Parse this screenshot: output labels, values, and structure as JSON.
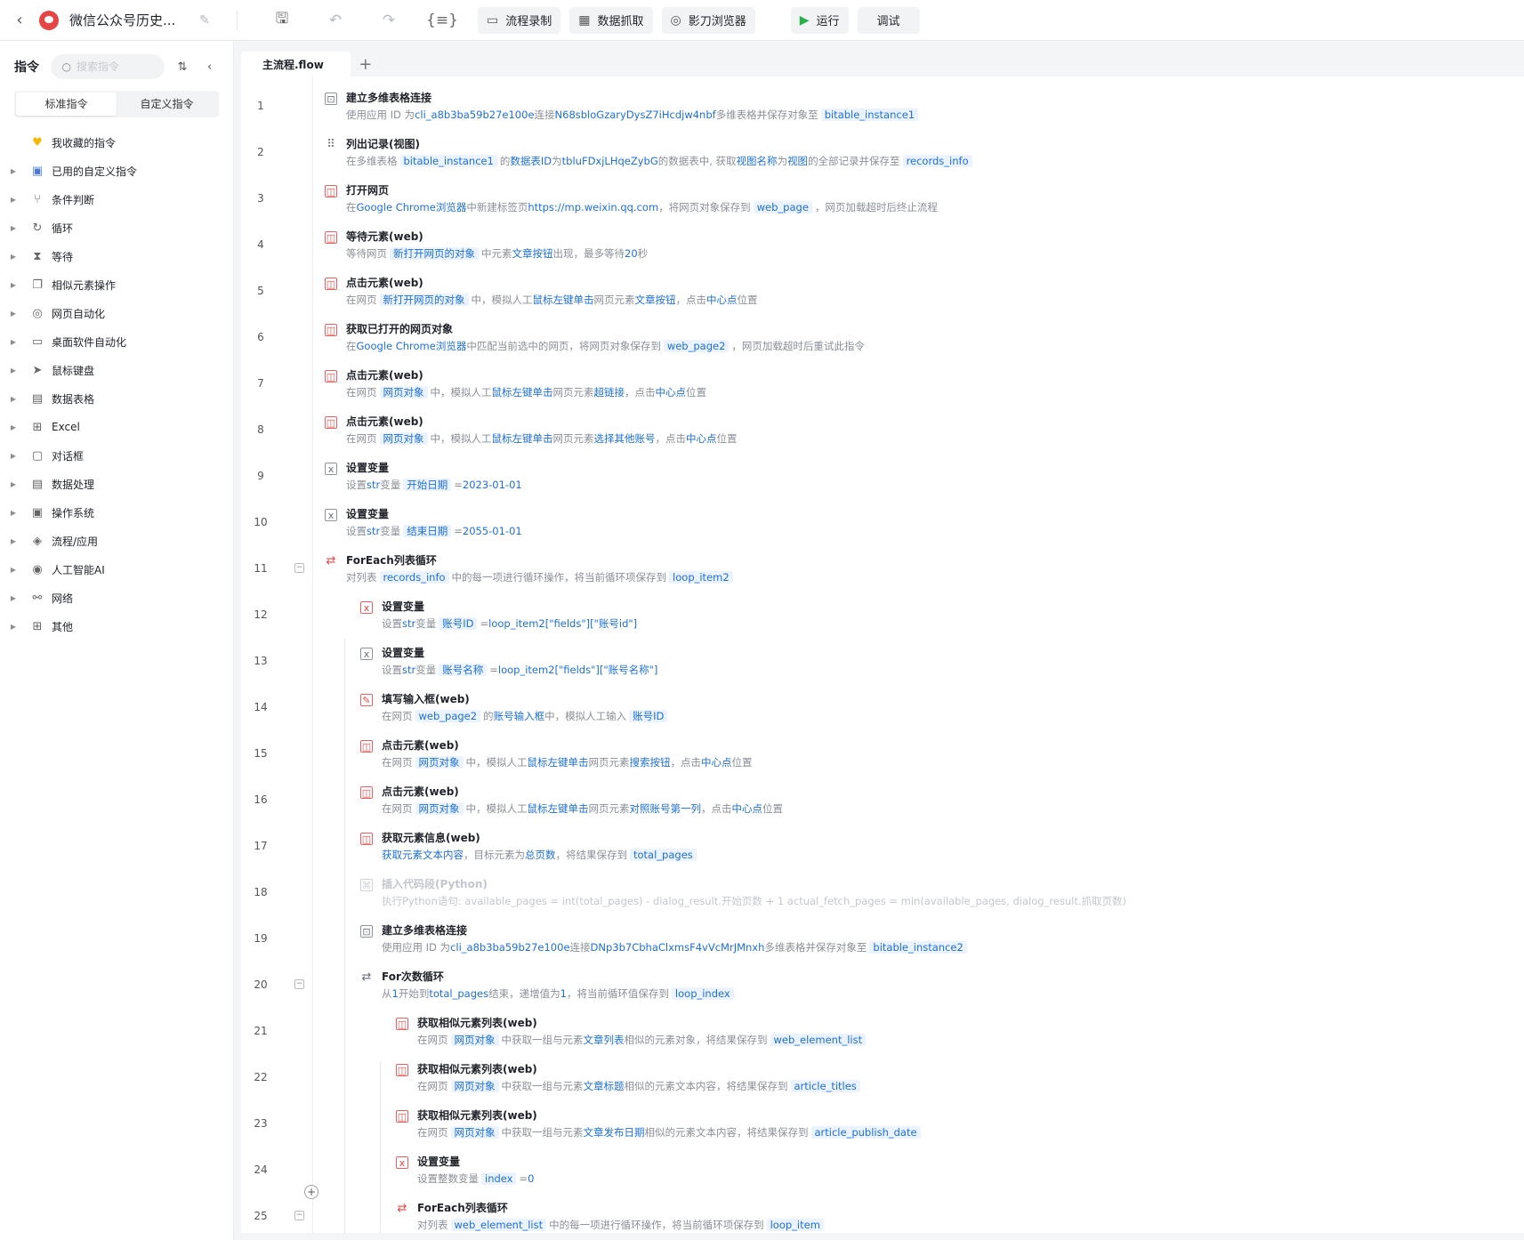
{
  "header": {
    "back_icon": "chevron-left",
    "app_title": "微信公众号历史...",
    "toolbar": {
      "flow_record": "流程录制",
      "data_capture": "数据抓取",
      "shadow_browser": "影刀浏览器",
      "run": "运行",
      "debug": "调试"
    }
  },
  "sidebar": {
    "title": "指令",
    "search_placeholder": "搜索指令",
    "tabs": [
      "标准指令",
      "自定义指令"
    ],
    "items": [
      {
        "label": "我收藏的指令",
        "icon": "heart-icon",
        "expandable": false
      },
      {
        "label": "已用的自定义指令",
        "icon": "calendar-icon",
        "expandable": true
      },
      {
        "label": "条件判断",
        "icon": "branch-icon",
        "expandable": true
      },
      {
        "label": "循环",
        "icon": "loop-icon",
        "expandable": true
      },
      {
        "label": "等待",
        "icon": "hourglass-icon",
        "expandable": true
      },
      {
        "label": "相似元素操作",
        "icon": "copy-icon",
        "expandable": true
      },
      {
        "label": "网页自动化",
        "icon": "browser-icon",
        "expandable": true
      },
      {
        "label": "桌面软件自动化",
        "icon": "monitor-icon",
        "expandable": true
      },
      {
        "label": "鼠标键盘",
        "icon": "cursor-icon",
        "expandable": true
      },
      {
        "label": "数据表格",
        "icon": "table-icon",
        "expandable": true
      },
      {
        "label": "Excel",
        "icon": "excel-icon",
        "expandable": true
      },
      {
        "label": "对话框",
        "icon": "dialog-icon",
        "expandable": true
      },
      {
        "label": "数据处理",
        "icon": "data-icon",
        "expandable": true
      },
      {
        "label": "操作系统",
        "icon": "os-icon",
        "expandable": true
      },
      {
        "label": "流程/应用",
        "icon": "layers-icon",
        "expandable": true
      },
      {
        "label": "人工智能AI",
        "icon": "ai-icon",
        "expandable": true
      },
      {
        "label": "网络",
        "icon": "network-icon",
        "expandable": true
      },
      {
        "label": "其他",
        "icon": "grid-icon",
        "expandable": true
      }
    ]
  },
  "editor": {
    "tab_name": "主流程.flow",
    "add_tab": "+",
    "steps": [
      {
        "n": "1",
        "depth": 0,
        "fold": false,
        "icon": "table-link-icon",
        "red": false,
        "title": "建立多维表格连接",
        "desc": [
          {
            "t": "使用应用 ID 为"
          },
          {
            "k": "cli_a8b3ba59b27e100e"
          },
          {
            "t": "连接"
          },
          {
            "k": "N68sbloGzaryDysZ7iHcdjw4nbf"
          },
          {
            "t": "多维表格并保存对象至"
          },
          {
            "v": "bitable_instance1"
          }
        ]
      },
      {
        "n": "2",
        "depth": 0,
        "fold": false,
        "icon": "grid-dots-icon",
        "red": false,
        "title": "列出记录(视图)",
        "desc": [
          {
            "t": "在多维表格"
          },
          {
            "v": "bitable_instance1"
          },
          {
            "t": "的"
          },
          {
            "k": "数据表ID"
          },
          {
            "t": "为"
          },
          {
            "k": "tbluFDxjLHqeZybG"
          },
          {
            "t": "的数据表中, 获取"
          },
          {
            "k": "视图名称"
          },
          {
            "t": "为"
          },
          {
            "k": "视图"
          },
          {
            "t": "的全部记录并保存至"
          },
          {
            "v": "records_info"
          }
        ]
      },
      {
        "n": "3",
        "depth": 0,
        "fold": false,
        "icon": "open-page-icon",
        "red": true,
        "title": "打开网页",
        "desc": [
          {
            "t": "在"
          },
          {
            "k": "Google Chrome浏览器"
          },
          {
            "t": "中新建标签页"
          },
          {
            "k": "https://mp.weixin.qq.com"
          },
          {
            "t": "，将网页对象保存到"
          },
          {
            "v": "web_page"
          },
          {
            "t": "，网页加载超时后终止流程"
          }
        ]
      },
      {
        "n": "4",
        "depth": 0,
        "fold": false,
        "icon": "wait-element-icon",
        "red": true,
        "title": "等待元素(web)",
        "desc": [
          {
            "t": "等待网页"
          },
          {
            "v": "新打开网页的对象"
          },
          {
            "t": "中元素"
          },
          {
            "k": "文章按钮"
          },
          {
            "t": "出现，最多等待"
          },
          {
            "k": "20"
          },
          {
            "t": "秒"
          }
        ]
      },
      {
        "n": "5",
        "depth": 0,
        "fold": false,
        "icon": "click-element-icon",
        "red": true,
        "title": "点击元素(web)",
        "desc": [
          {
            "t": "在网页"
          },
          {
            "v": "新打开网页的对象"
          },
          {
            "t": "中，模拟人工"
          },
          {
            "k": "鼠标左键单击"
          },
          {
            "t": "网页元素"
          },
          {
            "k": "文章按钮"
          },
          {
            "t": "，点击"
          },
          {
            "k": "中心点"
          },
          {
            "t": "位置"
          }
        ]
      },
      {
        "n": "6",
        "depth": 0,
        "fold": false,
        "icon": "get-page-icon",
        "red": true,
        "title": "获取已打开的网页对象",
        "desc": [
          {
            "t": "在"
          },
          {
            "k": "Google Chrome浏览器"
          },
          {
            "t": "中匹配当前选中的网页，将网页对象保存到"
          },
          {
            "v": "web_page2"
          },
          {
            "t": "，网页加载超时后重试此指令"
          }
        ]
      },
      {
        "n": "7",
        "depth": 0,
        "fold": false,
        "icon": "click-element-icon",
        "red": true,
        "title": "点击元素(web)",
        "desc": [
          {
            "t": "在网页"
          },
          {
            "v": "网页对象"
          },
          {
            "t": "中，模拟人工"
          },
          {
            "k": "鼠标左键单击"
          },
          {
            "t": "网页元素"
          },
          {
            "k": "超链接"
          },
          {
            "t": "，点击"
          },
          {
            "k": "中心点"
          },
          {
            "t": "位置"
          }
        ]
      },
      {
        "n": "8",
        "depth": 0,
        "fold": false,
        "icon": "click-element-icon",
        "red": true,
        "title": "点击元素(web)",
        "desc": [
          {
            "t": "在网页"
          },
          {
            "v": "网页对象"
          },
          {
            "t": "中，模拟人工"
          },
          {
            "k": "鼠标左键单击"
          },
          {
            "t": "网页元素"
          },
          {
            "k": "选择其他账号"
          },
          {
            "t": "，点击"
          },
          {
            "k": "中心点"
          },
          {
            "t": "位置"
          }
        ]
      },
      {
        "n": "9",
        "depth": 0,
        "fold": false,
        "icon": "variable-icon",
        "red": false,
        "title": "设置变量",
        "desc": [
          {
            "t": "设置"
          },
          {
            "k": "str"
          },
          {
            "t": "变量"
          },
          {
            "v": "开始日期"
          },
          {
            "t": "="
          },
          {
            "k": "2023-01-01"
          }
        ]
      },
      {
        "n": "10",
        "depth": 0,
        "fold": false,
        "icon": "variable-icon",
        "red": false,
        "title": "设置变量",
        "desc": [
          {
            "t": "设置"
          },
          {
            "k": "str"
          },
          {
            "t": "变量"
          },
          {
            "v": "结束日期"
          },
          {
            "t": "="
          },
          {
            "k": "2055-01-01"
          }
        ]
      },
      {
        "n": "11",
        "depth": 0,
        "fold": true,
        "icon": "foreach-icon",
        "red": true,
        "title": "ForEach列表循环",
        "desc": [
          {
            "t": "对列表"
          },
          {
            "v": "records_info"
          },
          {
            "t": "中的每一项进行循环操作，将当前循环项保存到"
          },
          {
            "v": "loop_item2"
          }
        ]
      },
      {
        "n": "12",
        "depth": 1,
        "fold": false,
        "icon": "variable-icon",
        "red": true,
        "title": "设置变量",
        "desc": [
          {
            "t": "设置"
          },
          {
            "k": "str"
          },
          {
            "t": "变量"
          },
          {
            "v": "账号ID"
          },
          {
            "t": "="
          },
          {
            "k": "loop_item2[\"fields\"][\"账号id\"]"
          }
        ]
      },
      {
        "n": "13",
        "depth": 1,
        "fold": false,
        "icon": "variable-icon",
        "red": false,
        "title": "设置变量",
        "desc": [
          {
            "t": "设置"
          },
          {
            "k": "str"
          },
          {
            "t": "变量"
          },
          {
            "v": "账号名称"
          },
          {
            "t": "="
          },
          {
            "k": "loop_item2[\"fields\"][\"账号名称\"]"
          }
        ]
      },
      {
        "n": "14",
        "depth": 1,
        "fold": false,
        "icon": "input-icon",
        "red": true,
        "title": "填写输入框(web)",
        "desc": [
          {
            "t": "在网页"
          },
          {
            "v": "web_page2"
          },
          {
            "t": "的"
          },
          {
            "k": "账号输入框"
          },
          {
            "t": "中，模拟人工输入"
          },
          {
            "v": "账号ID"
          }
        ]
      },
      {
        "n": "15",
        "depth": 1,
        "fold": false,
        "icon": "click-element-icon",
        "red": true,
        "title": "点击元素(web)",
        "desc": [
          {
            "t": "在网页"
          },
          {
            "v": "网页对象"
          },
          {
            "t": "中，模拟人工"
          },
          {
            "k": "鼠标左键单击"
          },
          {
            "t": "网页元素"
          },
          {
            "k": "搜索按钮"
          },
          {
            "t": "，点击"
          },
          {
            "k": "中心点"
          },
          {
            "t": "位置"
          }
        ]
      },
      {
        "n": "16",
        "depth": 1,
        "fold": false,
        "icon": "click-element-icon",
        "red": true,
        "title": "点击元素(web)",
        "desc": [
          {
            "t": "在网页"
          },
          {
            "v": "网页对象"
          },
          {
            "t": "中，模拟人工"
          },
          {
            "k": "鼠标左键单击"
          },
          {
            "t": "网页元素"
          },
          {
            "k": "对照账号第一列"
          },
          {
            "t": "，点击"
          },
          {
            "k": "中心点"
          },
          {
            "t": "位置"
          }
        ]
      },
      {
        "n": "17",
        "depth": 1,
        "fold": false,
        "icon": "element-info-icon",
        "red": true,
        "title": "获取元素信息(web)",
        "desc": [
          {
            "k": "获取元素文本内容"
          },
          {
            "t": "，目标元素为"
          },
          {
            "k": "总页数"
          },
          {
            "t": "，将结果保存到"
          },
          {
            "v": "total_pages"
          }
        ]
      },
      {
        "n": "18",
        "depth": 1,
        "fold": false,
        "icon": "code-icon",
        "red": false,
        "disabled": true,
        "title": "插入代码段(Python)",
        "desc": [
          {
            "t": "执行Python语句:  available_pages = int(total_pages) - dialog_result.开始页数 + 1 actual_fetch_pages = min(available_pages, dialog_result.抓取页数)"
          }
        ]
      },
      {
        "n": "19",
        "depth": 1,
        "fold": false,
        "icon": "table-link-icon",
        "red": false,
        "title": "建立多维表格连接",
        "desc": [
          {
            "t": "使用应用 ID 为"
          },
          {
            "k": "cli_a8b3ba59b27e100e"
          },
          {
            "t": "连接"
          },
          {
            "k": "DNp3b7CbhaClxmsF4vVcMrJMnxh"
          },
          {
            "t": "多维表格并保存对象至"
          },
          {
            "v": "bitable_instance2"
          }
        ]
      },
      {
        "n": "20",
        "depth": 1,
        "fold": true,
        "icon": "for-icon",
        "red": false,
        "title": "For次数循环",
        "desc": [
          {
            "t": "从"
          },
          {
            "k": "1"
          },
          {
            "t": "开始到"
          },
          {
            "k": "total_pages"
          },
          {
            "t": "结束，递增值为"
          },
          {
            "k": "1"
          },
          {
            "t": "，将当前循环值保存到"
          },
          {
            "v": "loop_index"
          }
        ]
      },
      {
        "n": "21",
        "depth": 2,
        "fold": false,
        "icon": "similar-list-icon",
        "red": true,
        "title": "获取相似元素列表(web)",
        "desc": [
          {
            "t": "在网页"
          },
          {
            "v": "网页对象"
          },
          {
            "t": "中获取一组与元素"
          },
          {
            "k": "文章列表"
          },
          {
            "t": "相似的元素对象，将结果保存到"
          },
          {
            "v": "web_element_list"
          }
        ]
      },
      {
        "n": "22",
        "depth": 2,
        "fold": false,
        "icon": "similar-list-icon",
        "red": true,
        "title": "获取相似元素列表(web)",
        "desc": [
          {
            "t": "在网页"
          },
          {
            "v": "网页对象"
          },
          {
            "t": "中获取一组与元素"
          },
          {
            "k": "文章标题"
          },
          {
            "t": "相似的元素文本内容，将结果保存到"
          },
          {
            "v": "article_titles"
          }
        ]
      },
      {
        "n": "23",
        "depth": 2,
        "fold": false,
        "icon": "similar-list-icon",
        "red": true,
        "title": "获取相似元素列表(web)",
        "desc": [
          {
            "t": "在网页"
          },
          {
            "v": "网页对象"
          },
          {
            "t": "中获取一组与元素"
          },
          {
            "k": "文章发布日期"
          },
          {
            "t": "相似的元素文本内容，将结果保存到"
          },
          {
            "v": "article_publish_date"
          }
        ]
      },
      {
        "n": "24",
        "depth": 2,
        "fold": false,
        "icon": "variable-icon",
        "red": true,
        "title": "设置变量",
        "desc": [
          {
            "t": "设置整数变量"
          },
          {
            "v": "index"
          },
          {
            "t": "="
          },
          {
            "k": "0"
          }
        ]
      },
      {
        "n": "25",
        "depth": 2,
        "fold": true,
        "icon": "foreach-icon",
        "red": true,
        "title": "ForEach列表循环",
        "desc": [
          {
            "t": "对列表"
          },
          {
            "v": "web_element_list"
          },
          {
            "t": "中的每一项进行循环操作，将当前循环项保存到"
          },
          {
            "v": "loop_item"
          }
        ]
      }
    ]
  }
}
